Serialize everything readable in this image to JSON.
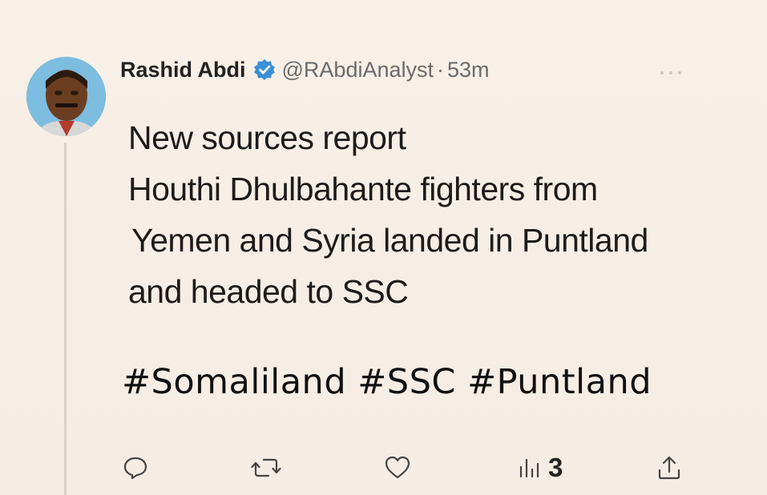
{
  "author": {
    "name": "Rashid Abdi",
    "handle": "@RAbdiAnalyst",
    "separator": "·",
    "time": "53m"
  },
  "icons": {
    "verified": "verified-badge-icon",
    "more": "more-options-icon",
    "reply": "reply-icon",
    "retweet": "retweet-icon",
    "like": "like-icon",
    "views": "views-icon",
    "share": "share-icon"
  },
  "tweet": {
    "lines": [
      "New sources report",
      "Houthi Dhulbahante fighters from",
      "Yemen  and Syria landed in Puntland",
      "and headed to SSC"
    ],
    "hashtags": "#Somaliland #SSC #Puntland"
  },
  "actions": {
    "views_count": "3"
  },
  "colors": {
    "background": "#f7efe5",
    "verified": "#3a8fd6",
    "text": "#1d1b1a",
    "muted": "#6a6a6a"
  }
}
